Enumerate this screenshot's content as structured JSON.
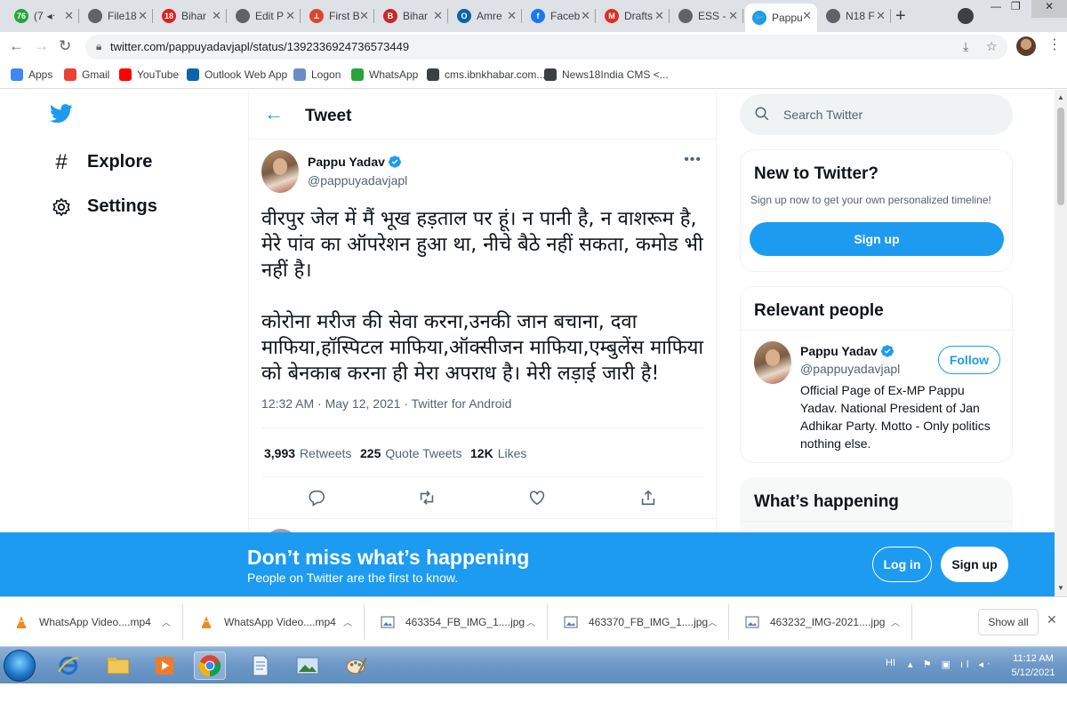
{
  "browser": {
    "tabs": [
      {
        "label": "(7",
        "favicon_color": "#25a53c",
        "favicon_text": "76",
        "audio": "◂ᐧ"
      },
      {
        "label": "File18",
        "favicon_color": "#5f6368",
        "favicon_text": ""
      },
      {
        "label": "Bihar",
        "favicon_color": "#e02020",
        "favicon_text": "18"
      },
      {
        "label": "Edit P",
        "favicon_color": "#5f6368",
        "favicon_text": ""
      },
      {
        "label": "First B",
        "favicon_color": "#d9472b",
        "favicon_text": "⟂"
      },
      {
        "label": "Bihar",
        "favicon_color": "#c62828",
        "favicon_text": "B"
      },
      {
        "label": "Amre",
        "favicon_color": "#0a64ad",
        "favicon_text": "O"
      },
      {
        "label": "Faceb",
        "favicon_color": "#1877f2",
        "favicon_text": "f"
      },
      {
        "label": "Drafts",
        "favicon_color": "#d93025",
        "favicon_text": "M"
      },
      {
        "label": "ESS -",
        "favicon_color": "#5f6368",
        "favicon_text": ""
      },
      {
        "label": "Pappu",
        "favicon_color": "#1d9bf0",
        "favicon_text": "🐦",
        "active": true
      },
      {
        "label": "N18 F",
        "favicon_color": "#5f6368",
        "favicon_text": ""
      }
    ],
    "url": "twitter.com/pappuyadavjapl/status/1392336924736573449",
    "bookmarks": [
      {
        "label": "Apps",
        "color": "#4285f4"
      },
      {
        "label": "Gmail",
        "color": "#ea4335"
      },
      {
        "label": "YouTube",
        "color": "#ff0000"
      },
      {
        "label": "Outlook Web App",
        "color": "#0a64ad"
      },
      {
        "label": "Logon",
        "color": "#6b8cc7"
      },
      {
        "label": "WhatsApp",
        "color": "#25a53c"
      },
      {
        "label": "cms.ibnkhabar.com...",
        "color": "#3c4043"
      },
      {
        "label": "News18India CMS <...",
        "color": "#3c4043"
      }
    ]
  },
  "twitter": {
    "nav": {
      "explore": "Explore",
      "settings": "Settings"
    },
    "header_title": "Tweet",
    "tweet": {
      "author_name": "Pappu Yadav",
      "author_handle": "@pappuyadavjapl",
      "text_p1": "वीरपुर जेल में मैं भूख हड़ताल पर हूं। न पानी है, न वाशरूम है, मेरे पांव का ऑपरेशन हुआ था, नीचे बैठे नहीं सकता, कमोड भी नहीं है।",
      "text_p2": "कोरोना मरीज की सेवा करना,उनकी जान बचाना, दवा माफिया,हॉस्पिटल माफिया,ऑक्सीजन माफिया,एम्बुलेंस माफिया को बेनकाब करना ही मेरा अपराध है। मेरी लड़ाई जारी है!",
      "meta": "12:32 AM · May 12, 2021 · Twitter for Android",
      "retweets_count": "3,993",
      "retweets_label": "Retweets",
      "quotes_count": "225",
      "quotes_label": "Quote Tweets",
      "likes_count": "12K",
      "likes_label": "Likes"
    },
    "search_placeholder": "Search Twitter",
    "new_to_twitter": {
      "title": "New to Twitter?",
      "subtitle": "Sign up now to get your own personalized timeline!",
      "signup": "Sign up"
    },
    "relevant_people": {
      "title": "Relevant people",
      "name": "Pappu Yadav",
      "handle": "@pappuyadavjapl",
      "follow": "Follow",
      "bio": "Official Page of Ex-MP Pappu Yadav. National President of Jan Adhikar Party. Motto - Only politics nothing else."
    },
    "whats_happening": "What’s happening",
    "banner": {
      "title": "Don’t miss what’s happening",
      "subtitle": "People on Twitter are the first to know.",
      "login": "Log in",
      "signup": "Sign up"
    },
    "accent_color": "#1d9bf0"
  },
  "downloads": {
    "items": [
      {
        "label": "WhatsApp Video....mp4",
        "type": "vlc"
      },
      {
        "label": "WhatsApp Video....mp4",
        "type": "vlc"
      },
      {
        "label": "463354_FB_IMG_1....jpg",
        "type": "image"
      },
      {
        "label": "463370_FB_IMG_1....jpg",
        "type": "image"
      },
      {
        "label": "463232_IMG-2021....jpg",
        "type": "image"
      }
    ],
    "show_all": "Show all"
  },
  "taskbar": {
    "lang": "HI",
    "time": "11:12 AM",
    "date": "5/12/2021"
  }
}
